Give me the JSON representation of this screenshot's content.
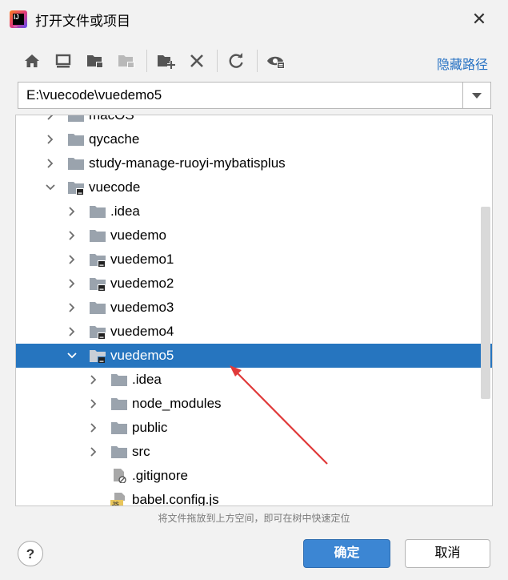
{
  "window": {
    "title": "打开文件或项目",
    "close_glyph": "✕"
  },
  "toolbar": {
    "buttons": [
      {
        "name": "home-icon"
      },
      {
        "name": "desktop-icon"
      },
      {
        "name": "project-folder-icon"
      },
      {
        "name": "module-folder-icon"
      },
      {
        "name": "new-folder-icon"
      },
      {
        "name": "delete-icon"
      },
      {
        "name": "refresh-icon"
      },
      {
        "name": "show-hidden-icon"
      }
    ],
    "hide_path_label": "隐藏路径"
  },
  "path": {
    "value": "E:\\vuecode\\vuedemo5"
  },
  "tree": {
    "rows": [
      {
        "label": "macOS",
        "expanded": false,
        "icon": "folder"
      },
      {
        "label": "qycache",
        "expanded": false,
        "icon": "folder"
      },
      {
        "label": "study-manage-ruoyi-mybatisplus",
        "expanded": false,
        "icon": "folder"
      },
      {
        "label": "vuecode",
        "expanded": true,
        "icon": "project-folder"
      },
      {
        "label": ".idea",
        "expanded": false,
        "icon": "folder"
      },
      {
        "label": "vuedemo",
        "expanded": false,
        "icon": "folder"
      },
      {
        "label": "vuedemo1",
        "expanded": false,
        "icon": "project-folder"
      },
      {
        "label": "vuedemo2",
        "expanded": false,
        "icon": "project-folder"
      },
      {
        "label": "vuedemo3",
        "expanded": false,
        "icon": "folder"
      },
      {
        "label": "vuedemo4",
        "expanded": false,
        "icon": "project-folder"
      },
      {
        "label": "vuedemo5",
        "expanded": true,
        "icon": "project-folder",
        "selected": true
      },
      {
        "label": ".idea",
        "expanded": false,
        "icon": "folder"
      },
      {
        "label": "node_modules",
        "expanded": false,
        "icon": "folder"
      },
      {
        "label": "public",
        "expanded": false,
        "icon": "folder"
      },
      {
        "label": "src",
        "expanded": false,
        "icon": "folder"
      },
      {
        "label": ".gitignore",
        "icon": "ignored-file"
      },
      {
        "label": "babel.config.js",
        "icon": "js-file"
      }
    ]
  },
  "hint": "将文件拖放到上方空间，即可在树中快速定位",
  "footer": {
    "help": "?",
    "ok_label": "确定",
    "cancel_label": "取消"
  },
  "colors": {
    "selection": "#2675bf",
    "link": "#2470c3",
    "ok_button": "#3c86d3",
    "annotation_arrow": "#e03a3a"
  }
}
